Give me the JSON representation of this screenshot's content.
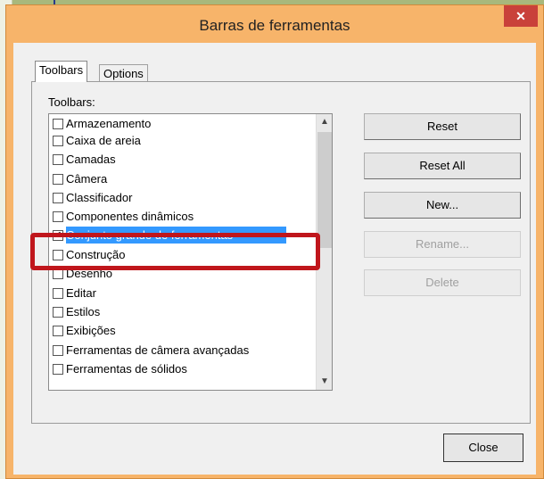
{
  "window": {
    "title": "Barras de ferramentas",
    "close_glyph": "✕"
  },
  "tabs": [
    {
      "label": "Toolbars",
      "active": true
    },
    {
      "label": "Options",
      "active": false
    }
  ],
  "list": {
    "label": "Toolbars:",
    "items": [
      {
        "label": "Armazenamento",
        "checked": false
      },
      {
        "label": "Caixa de areia",
        "checked": false
      },
      {
        "label": "Camadas",
        "checked": false
      },
      {
        "label": "Câmera",
        "checked": false
      },
      {
        "label": "Classificador",
        "checked": false
      },
      {
        "label": "Componentes dinâmicos",
        "checked": false
      },
      {
        "label": "Conjunto grande de ferramentas",
        "checked": true,
        "selected": true
      },
      {
        "label": "Construção",
        "checked": false
      },
      {
        "label": "Desenho",
        "checked": false
      },
      {
        "label": "Editar",
        "checked": false
      },
      {
        "label": "Estilos",
        "checked": false
      },
      {
        "label": "Exibições",
        "checked": false
      },
      {
        "label": "Ferramentas de câmera avançadas",
        "checked": false
      },
      {
        "label": "Ferramentas de sólidos",
        "checked": false
      }
    ]
  },
  "buttons": {
    "reset": "Reset",
    "reset_all": "Reset All",
    "new": "New...",
    "rename": "Rename...",
    "delete": "Delete",
    "close": "Close"
  },
  "colors": {
    "selection": "#3399ff",
    "highlight_frame": "#c0161c",
    "title_bar": "#f7b46a"
  }
}
